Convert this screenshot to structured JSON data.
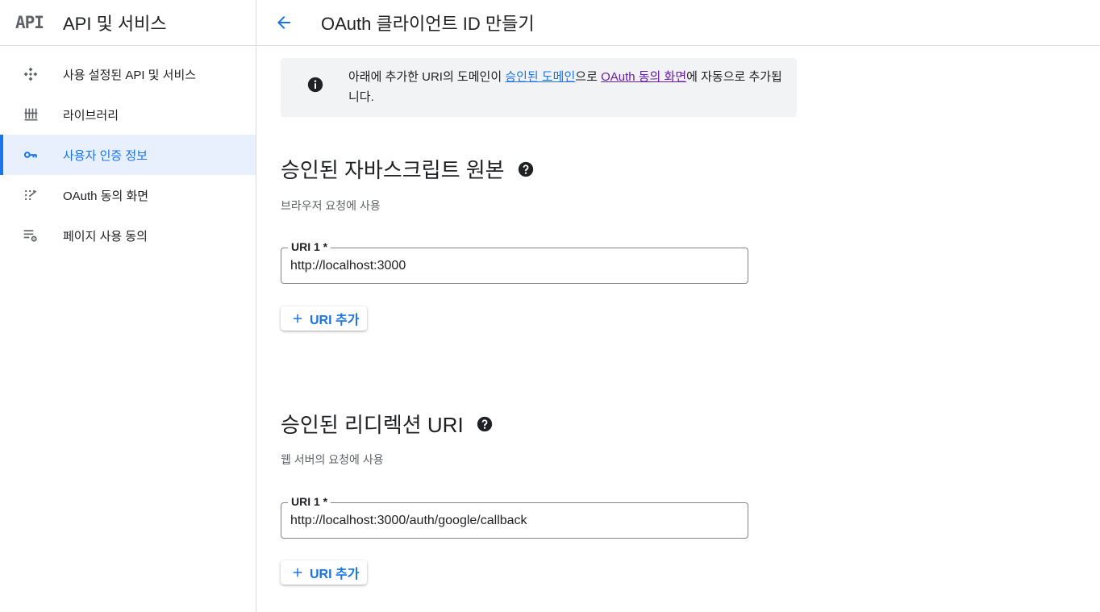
{
  "sidebar": {
    "logo": "API",
    "title": "API 및 서비스",
    "items": [
      {
        "label": "사용 설정된 API 및 서비스",
        "icon": "api-diamond-icon"
      },
      {
        "label": "라이브러리",
        "icon": "library-icon"
      },
      {
        "label": "사용자 인증 정보",
        "icon": "key-icon",
        "active": true
      },
      {
        "label": "OAuth 동의 화면",
        "icon": "consent-dots-icon"
      },
      {
        "label": "페이지 사용 동의",
        "icon": "settings-list-icon"
      }
    ]
  },
  "header": {
    "title": "OAuth 클라이언트 ID 만들기",
    "back_icon": "arrow-back-icon"
  },
  "info": {
    "text_1": "아래에 추가한 URI의 도메인이 ",
    "link_1": "승인된 도메인",
    "text_2": "으로 ",
    "link_2": "OAuth 동의 화면",
    "text_3": "에 자동으로 추가됩니다."
  },
  "js_origins": {
    "title": "승인된 자바스크립트 원본",
    "subtitle": "브라우저 요청에 사용",
    "field_label": "URI 1 *",
    "field_value": "http://localhost:3000",
    "add_label": "URI 추가"
  },
  "redirect_uris": {
    "title": "승인된 리디렉션 URI",
    "subtitle": "웹 서버의 요청에 사용",
    "field_label": "URI 1 *",
    "field_value": "http://localhost:3000/auth/google/callback",
    "add_label": "URI 추가"
  },
  "colors": {
    "accent": "#1a73e8",
    "active_bg": "#e8f0fe",
    "visited_link": "#681da8",
    "info_bg": "#f1f3f4"
  }
}
